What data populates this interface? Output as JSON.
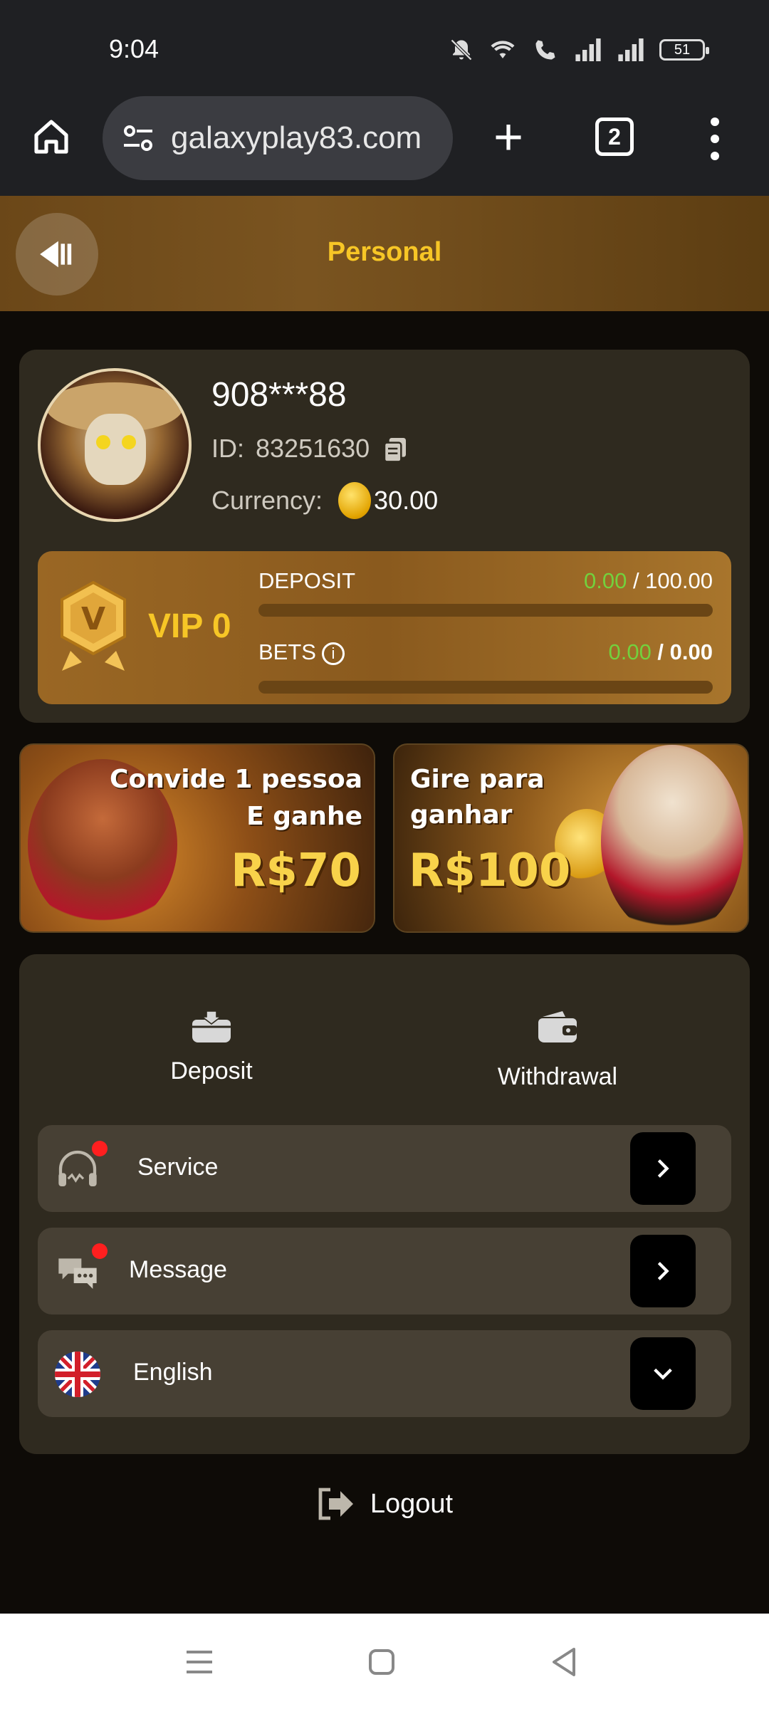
{
  "status_bar": {
    "time": "9:04",
    "battery": "51"
  },
  "browser": {
    "url": "galaxyplay83.com",
    "tab_count": "2"
  },
  "header": {
    "title": "Personal"
  },
  "profile": {
    "username": "908***88",
    "id_label": "ID:",
    "id_value": "83251630",
    "currency_label": "Currency:",
    "balance": "30.00"
  },
  "vip": {
    "level": "VIP 0",
    "deposit_label": "DEPOSIT",
    "deposit_current": "0.00",
    "deposit_target": " / 100.00",
    "deposit_progress": 0,
    "bets_label": "BETS",
    "bets_current": "0.00",
    "bets_target": " / 0.00",
    "bets_progress": 0
  },
  "banners": [
    {
      "line1": "Convide 1 pessoa",
      "line2": "E ganhe",
      "amount": "R$70"
    },
    {
      "line1": "Gire para",
      "line2": "ganhar",
      "amount": "R$100"
    }
  ],
  "actions": {
    "deposit": "Deposit",
    "withdrawal": "Withdrawal"
  },
  "menu": {
    "service": "Service",
    "message": "Message",
    "language": "English"
  },
  "logout": "Logout",
  "colors": {
    "accent": "#f7c626",
    "positive": "#73d13d",
    "card": "#2f2a1f"
  }
}
